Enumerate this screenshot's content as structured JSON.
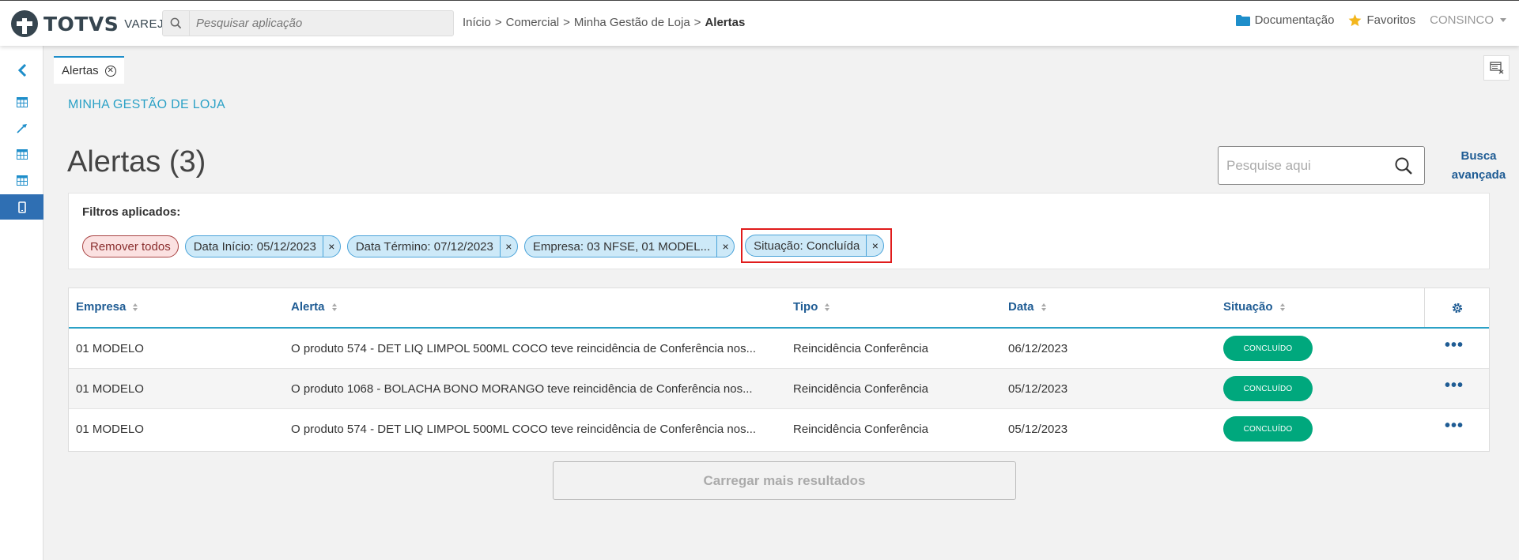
{
  "brand": {
    "name": "TOTVS",
    "sub": "VAREJO"
  },
  "app_search": {
    "placeholder": "Pesquisar aplicação"
  },
  "breadcrumb": {
    "items": [
      "Início",
      "Comercial",
      "Minha Gestão de Loja"
    ],
    "current": "Alertas",
    "separator": ">"
  },
  "header_right": {
    "docs": "Documentação",
    "favorites": "Favoritos",
    "user": "CONSINCO"
  },
  "sidebar": {
    "icons": [
      "chevron-left-icon",
      "table-icon",
      "pin-icon",
      "table-icon",
      "table-icon",
      "mobile-icon"
    ],
    "active_index": 5
  },
  "tab": {
    "label": "Alertas"
  },
  "section_title": "MINHA GESTÃO DE LOJA",
  "page_title": "Alertas (3)",
  "search": {
    "placeholder": "Pesquise aqui",
    "advanced": "Busca avançada"
  },
  "filters": {
    "label": "Filtros aplicados:",
    "remove_all": "Remover todos",
    "chips": [
      {
        "label": "Data Início: 05/12/2023"
      },
      {
        "label": "Data Término: 07/12/2023"
      },
      {
        "label": "Empresa: 03 NFSE, 01 MODEL..."
      },
      {
        "label": "Situação: Concluída"
      }
    ],
    "chip_close": "×"
  },
  "table": {
    "columns": [
      "Empresa",
      "Alerta",
      "Tipo",
      "Data",
      "Situação"
    ],
    "rows": [
      {
        "empresa": "01 MODELO",
        "alerta": "O produto 574 - DET LIQ LIMPOL 500ML COCO teve reincidência de Conferência nos...",
        "tipo": "Reincidência Conferência",
        "data": "06/12/2023",
        "situacao": "CONCLUÍDO"
      },
      {
        "empresa": "01 MODELO",
        "alerta": "O produto 1068 - BOLACHA BONO MORANGO teve reincidência de Conferência nos...",
        "tipo": "Reincidência Conferência",
        "data": "05/12/2023",
        "situacao": "CONCLUÍDO"
      },
      {
        "empresa": "01 MODELO",
        "alerta": "O produto 574 - DET LIQ LIMPOL 500ML COCO teve reincidência de Conferência nos...",
        "tipo": "Reincidência Conferência",
        "data": "05/12/2023",
        "situacao": "CONCLUÍDO"
      }
    ],
    "row_actions": "•••"
  },
  "load_more": "Carregar mais resultados",
  "colors": {
    "accent": "#2ba1c6",
    "link": "#1f5c94",
    "success": "#00a87d",
    "chip": "#cde9f8",
    "highlight": "#e01b1b",
    "active_sidebar": "#2f6fb3"
  }
}
